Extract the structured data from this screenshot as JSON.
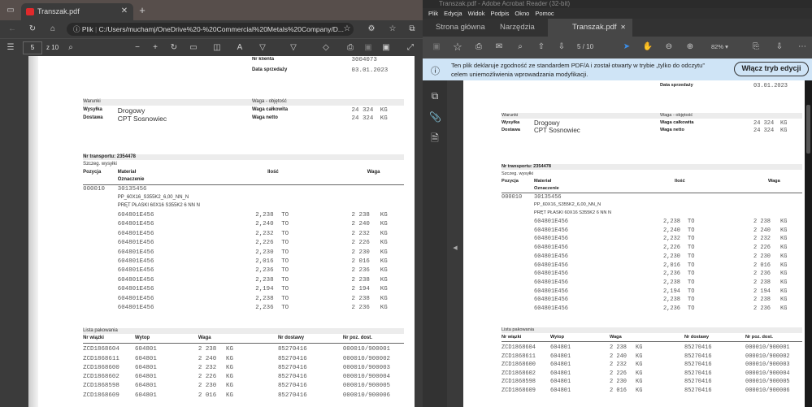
{
  "edge": {
    "tab_title": "Transzak.pdf",
    "address_prefix": "Plik",
    "url": "C:/Users/muchamj/OneDrive%20-%20Commercial%20Metals%20Company/D...",
    "page_current": "5",
    "page_total": "z 10"
  },
  "acrobat": {
    "window_title": "Transzak.pdf - Adobe Acrobat Reader (32-bit)",
    "menu": [
      "Plik",
      "Edycja",
      "Widok",
      "Podpis",
      "Okno",
      "Pomoc"
    ],
    "tabs": {
      "home": "Strona główna",
      "tools": "Narzędzia",
      "doc": "Transzak.pdf"
    },
    "page_current": "5",
    "page_total": "/ 10",
    "zoom": "82%",
    "banner_line1": "Ten plik deklaruje zgodność ze standardem PDF/A i został otwarty w trybie „tylko do odczytu”",
    "banner_line2": "celem uniemożliwienia wprowadzania modyfikacji.",
    "banner_button": "Włącz tryb edycji"
  },
  "doc": {
    "nr_klienta_label": "Nr klienta",
    "nr_klienta": "3004073",
    "data_label": "Data sprzedaży",
    "data": "03.01.2023",
    "warunki": "Warunki",
    "wysylka_label": "Wysyłka",
    "wysylka": "Drogowy",
    "dostawa_label": "Dostawa",
    "dostawa": "CPT Sosnowiec",
    "waga_obj": "Waga - objętość",
    "waga_calk_label": "Waga całkowita",
    "waga_calk": "24 324",
    "waga_netto_label": "Waga netto",
    "waga_netto": "24 324",
    "unit_kg": "KG",
    "unit_to": "TO",
    "transport": "Nr transportu: 2354478",
    "szczeg": "Szczeg. wysyłki",
    "headers": {
      "pozycja": "Pozycja",
      "material": "Materiał",
      "oznaczenie": "Oznaczenie",
      "ilosc": "Ilość",
      "waga": "Waga"
    },
    "pozycja": "000010",
    "material_no": "30135456",
    "material_code": "PP_60X16_S355K2_6,00_NN_N",
    "material_desc": "PRĘT PŁASKI 60X16 S355K2 6 NN N",
    "items": [
      {
        "charge": "604801E456",
        "qty": "2,238",
        "weight": "2 238"
      },
      {
        "charge": "604801E456",
        "qty": "2,240",
        "weight": "2 240"
      },
      {
        "charge": "604801E456",
        "qty": "2,232",
        "weight": "2 232"
      },
      {
        "charge": "604801E456",
        "qty": "2,226",
        "weight": "2 226"
      },
      {
        "charge": "604801E456",
        "qty": "2,230",
        "weight": "2 230"
      },
      {
        "charge": "604801E456",
        "qty": "2,016",
        "weight": "2 016"
      },
      {
        "charge": "604801E456",
        "qty": "2,236",
        "weight": "2 236"
      },
      {
        "charge": "604801E456",
        "qty": "2,238",
        "weight": "2 238"
      },
      {
        "charge": "604801E456",
        "qty": "2,194",
        "weight": "2 194"
      },
      {
        "charge": "604801E456",
        "qty": "2,238",
        "weight": "2 238"
      },
      {
        "charge": "604801E456",
        "qty": "2,236",
        "weight": "2 236"
      }
    ],
    "packing_title": "Lista pakowania",
    "packing_headers": [
      "Nr wiązki",
      "Wytop",
      "Waga",
      "Nr dostawy",
      "Nr poz. dost."
    ],
    "packing": [
      {
        "bundle": "ZCD1868604",
        "heat": "604801",
        "weight": "2 238",
        "delivery": "85270416",
        "pos": "000010/900001"
      },
      {
        "bundle": "ZCD1868611",
        "heat": "604801",
        "weight": "2 240",
        "delivery": "85270416",
        "pos": "000010/900002"
      },
      {
        "bundle": "ZCD1868600",
        "heat": "604801",
        "weight": "2 232",
        "delivery": "85270416",
        "pos": "000010/900003"
      },
      {
        "bundle": "ZCD1868602",
        "heat": "604801",
        "weight": "2 226",
        "delivery": "85270416",
        "pos": "000010/900004"
      },
      {
        "bundle": "ZCD1868598",
        "heat": "604801",
        "weight": "2 230",
        "delivery": "85270416",
        "pos": "000010/900005"
      },
      {
        "bundle": "ZCD1868609",
        "heat": "604801",
        "weight": "2 016",
        "delivery": "85270416",
        "pos": "000010/900006"
      }
    ]
  }
}
